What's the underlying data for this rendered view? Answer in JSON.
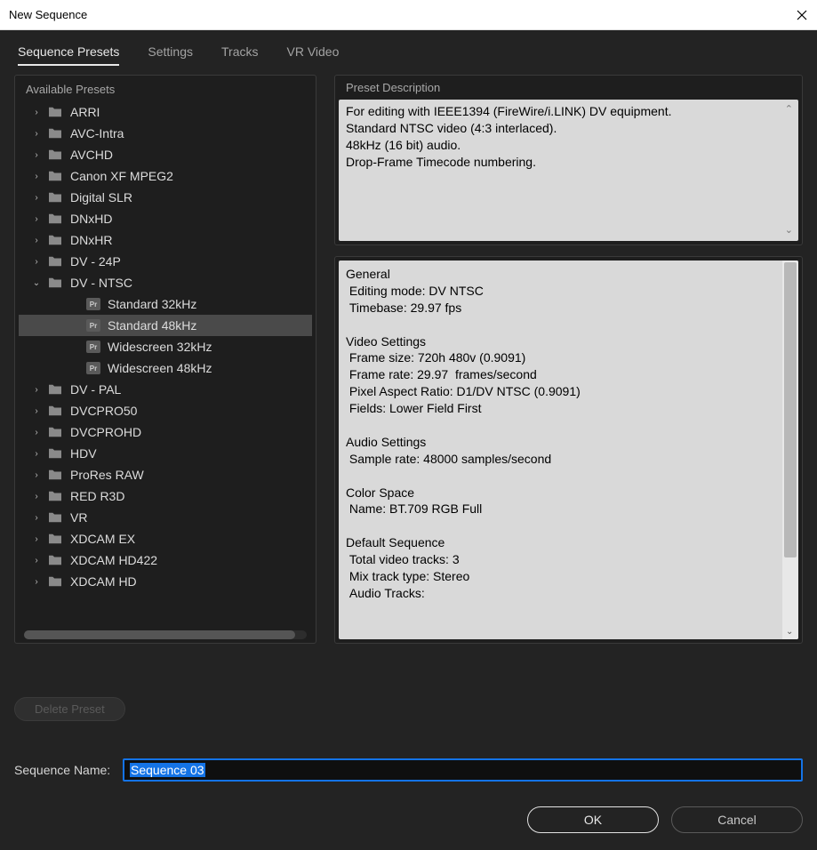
{
  "window": {
    "title": "New Sequence"
  },
  "tabs": {
    "presets": "Sequence Presets",
    "settings": "Settings",
    "tracks": "Tracks",
    "vr": "VR Video"
  },
  "presets": {
    "panelTitle": "Available Presets",
    "folders": [
      "ARRI",
      "AVC-Intra",
      "AVCHD",
      "Canon XF MPEG2",
      "Digital SLR",
      "DNxHD",
      "DNxHR",
      "DV - 24P",
      "DV - NTSC",
      "DV - PAL",
      "DVCPRO50",
      "DVCPROHD",
      "HDV",
      "ProRes RAW",
      "RED R3D",
      "VR",
      "XDCAM EX",
      "XDCAM HD422",
      "XDCAM HD"
    ],
    "expandedFolder": "DV - NTSC",
    "children": [
      "Standard 32kHz",
      "Standard 48kHz",
      "Widescreen 32kHz",
      "Widescreen 48kHz"
    ],
    "selected": "Standard 48kHz"
  },
  "description": {
    "panelTitle": "Preset Description",
    "line1": "For editing with IEEE1394 (FireWire/i.LINK) DV equipment.",
    "line2": "Standard NTSC video (4:3 interlaced).",
    "line3": "48kHz (16 bit) audio.",
    "line4": "Drop-Frame Timecode numbering."
  },
  "details": {
    "text": "General\n Editing mode: DV NTSC\n Timebase: 29.97 fps\n\nVideo Settings\n Frame size: 720h 480v (0.9091)\n Frame rate: 29.97  frames/second\n Pixel Aspect Ratio: D1/DV NTSC (0.9091)\n Fields: Lower Field First\n\nAudio Settings\n Sample rate: 48000 samples/second\n\nColor Space\n Name: BT.709 RGB Full\n\nDefault Sequence\n Total video tracks: 3\n Mix track type: Stereo\n Audio Tracks:"
  },
  "deletePreset": "Delete Preset",
  "sequenceName": {
    "label": "Sequence Name:",
    "value": "Sequence 03"
  },
  "buttons": {
    "ok": "OK",
    "cancel": "Cancel"
  }
}
